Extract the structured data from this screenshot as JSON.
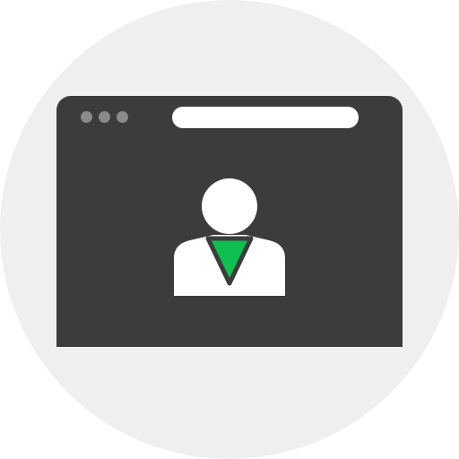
{
  "icon": {
    "name": "browser-user-profile-icon",
    "colors": {
      "background_circle": "#efefef",
      "window_frame": "#3c3c3c",
      "window_dots": "#8a8a8a",
      "address_bar": "#ffffff",
      "person": "#ffffff",
      "tie": "#0fbf4f",
      "tie_outline": "#3c3c3c"
    }
  }
}
